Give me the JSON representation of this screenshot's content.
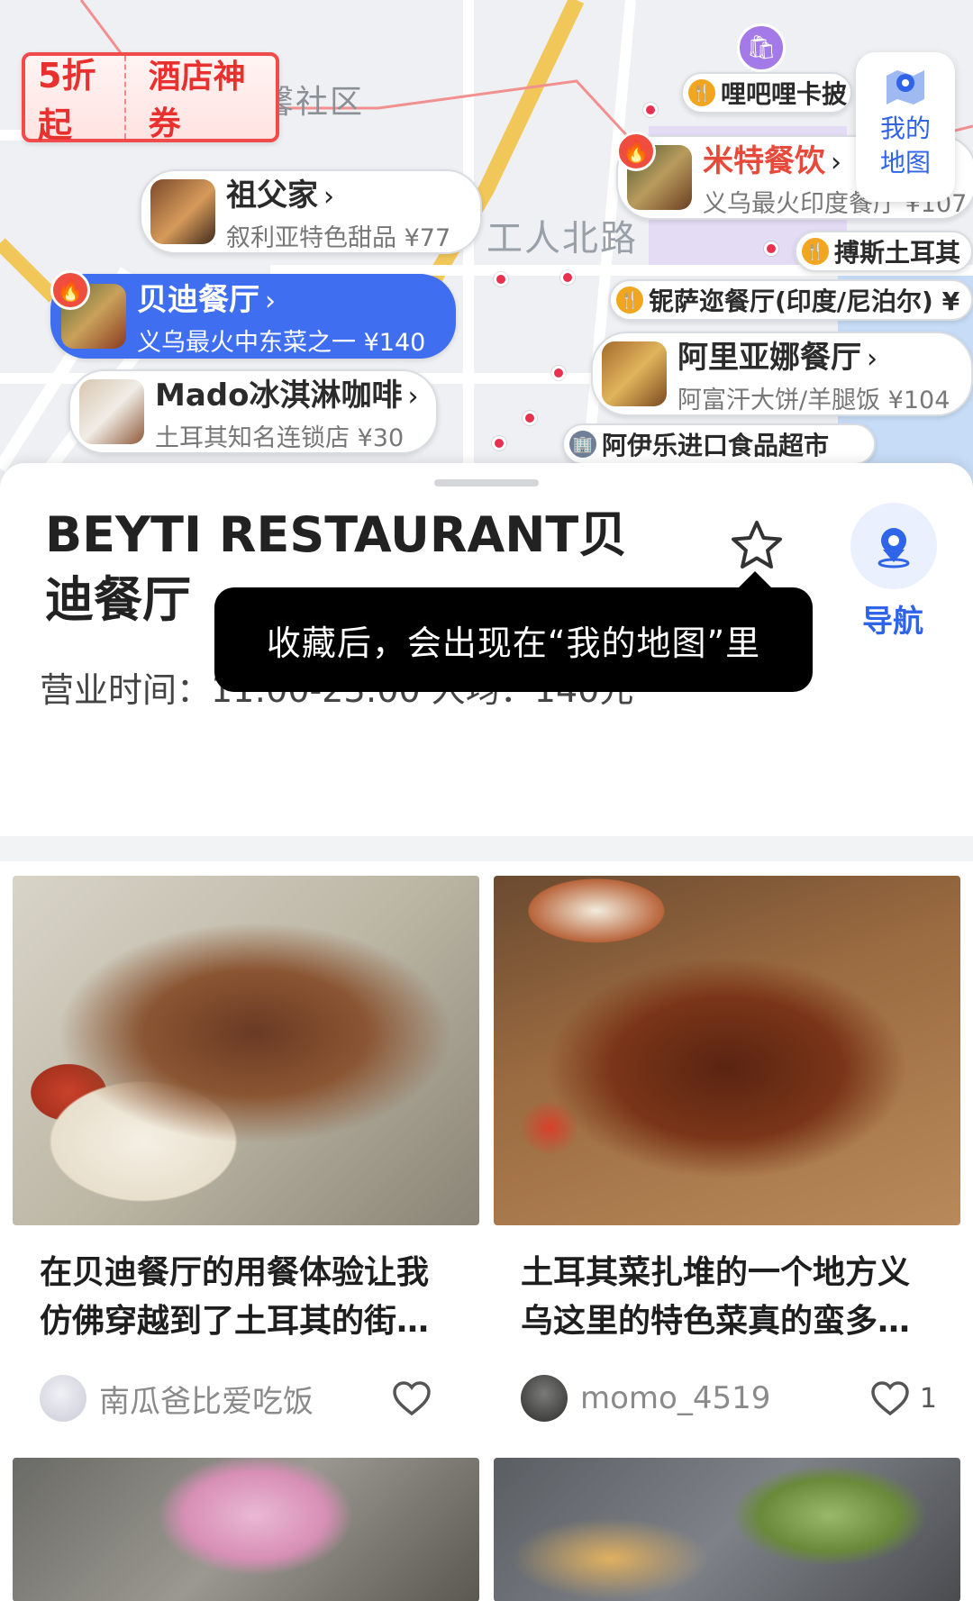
{
  "map": {
    "coupon": {
      "discount": "5折起",
      "label": "酒店神券"
    },
    "area_labels": [
      "馨社区",
      "工人北路"
    ],
    "my_map": {
      "label": "我的地图",
      "icon": "map-pin-icon"
    },
    "pois": [
      {
        "name": "祖父家",
        "sub": "叙利亚特色甜品 ¥77"
      },
      {
        "name": "贝迪餐厅",
        "sub": "义乌最火中东菜之一 ¥140"
      },
      {
        "name": "Mado冰淇淋咖啡",
        "sub": "土耳其知名连锁店 ¥30"
      },
      {
        "name": "米特餐饮",
        "sub": "义乌最火印度餐厅 ¥107"
      },
      {
        "name": "阿里亚娜餐厅",
        "sub": "阿富汗大饼/羊腿饭 ¥104"
      },
      {
        "name": "哩吧哩卡披"
      },
      {
        "name": "搏斯土耳其"
      },
      {
        "name": "铌萨迩餐厅(印度/尼泊尔) ¥"
      },
      {
        "name": "阿伊乐进口食品超市"
      }
    ]
  },
  "detail": {
    "title": "BEYTI RESTAURANT贝迪餐厅",
    "hours": "营业时间：11:00-23:00 人均：140元",
    "nav_label": "导航",
    "tooltip": "收藏后，会出现在“我的地图”里"
  },
  "feed": [
    {
      "title": "在贝迪餐厅的用餐体验让我仿佛穿越到了土耳其的街…",
      "author": "南瓜爸比爱吃饭",
      "likes": ""
    },
    {
      "title": "土耳其菜扎堆的一个地方义乌这里的特色菜真的蛮多…",
      "author": "momo_4519",
      "likes": "1"
    }
  ],
  "colors": {
    "accent": "#2f63e8",
    "selected_poi": "#3f6ef0",
    "hot": "#e74a3b",
    "coupon": "#e8312f"
  }
}
